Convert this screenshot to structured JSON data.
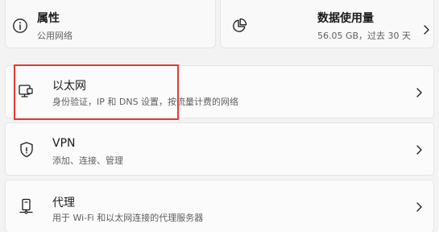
{
  "properties_card": {
    "title": "属性",
    "subtitle": "公用网络",
    "icon": "info-icon"
  },
  "data_usage_card": {
    "title": "数据使用量",
    "subtitle": "56.05 GB，过去 30 天",
    "icon": "pie-chart-icon"
  },
  "rows": [
    {
      "title": "以太网",
      "subtitle": "身份验证，IP 和 DNS 设置，按流量计费的网络",
      "icon": "ethernet-icon"
    },
    {
      "title": "VPN",
      "subtitle": "添加、连接、管理",
      "icon": "shield-icon"
    },
    {
      "title": "代理",
      "subtitle": "用于 Wi-Fi 和以太网连接的代理服务器",
      "icon": "proxy-server-icon"
    }
  ],
  "colors": {
    "highlight": "#e53935",
    "background": "#f3f3f3",
    "card": "#fbfbfb"
  }
}
